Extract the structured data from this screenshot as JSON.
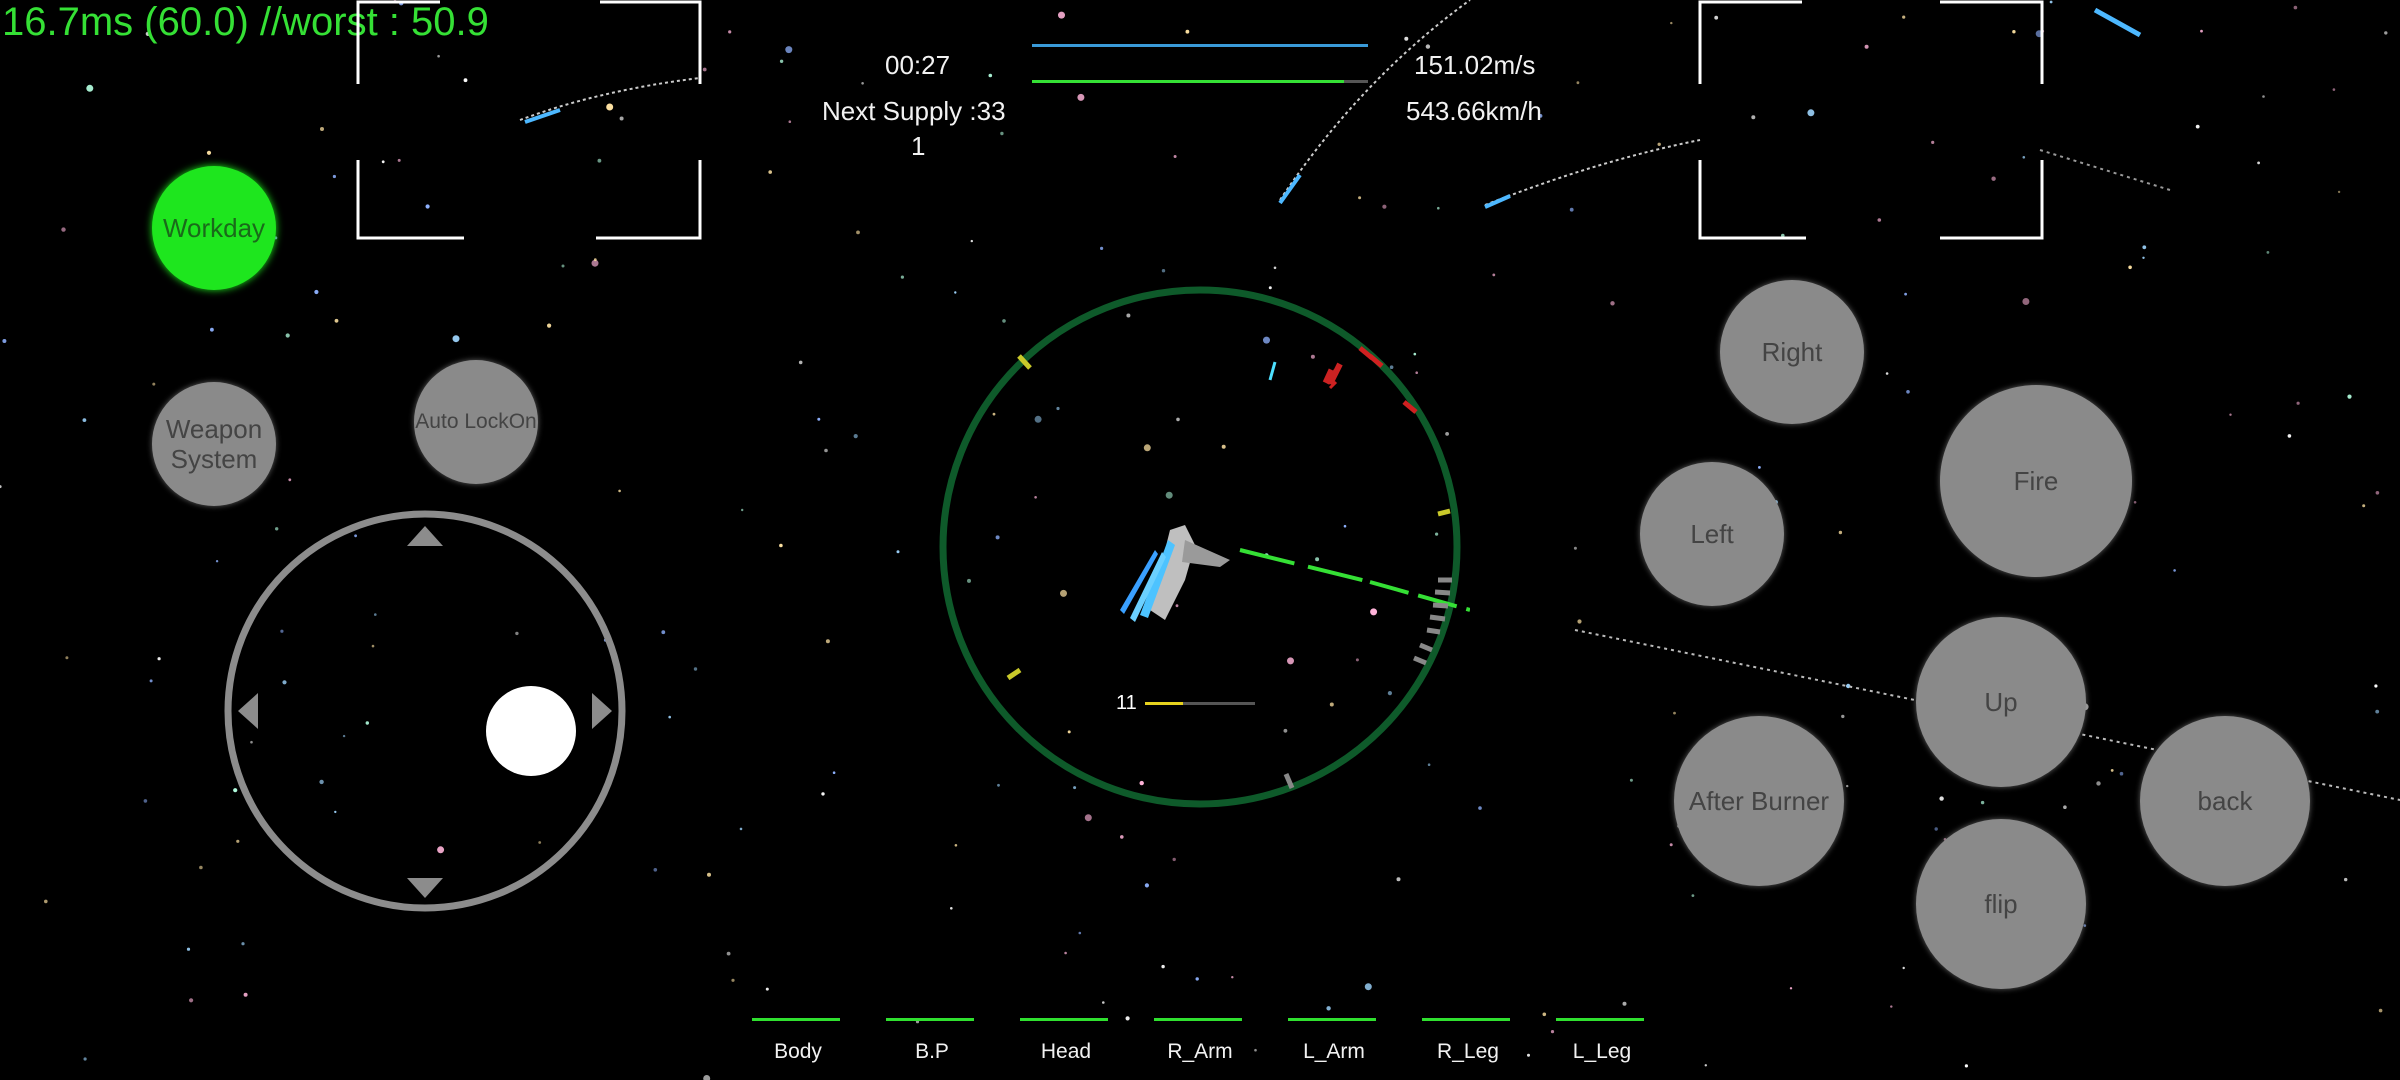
{
  "perf": {
    "text": "16.7ms (60.0) //worst : 50.9"
  },
  "hud": {
    "timer": "00:27",
    "next_supply": "Next Supply :33",
    "supply_count": "1",
    "speed_ms": "151.02m/s",
    "speed_kmh": "543.66km/h",
    "ammo_count": "11"
  },
  "buttons": {
    "workday": "Workday",
    "weapon_system": "Weapon System",
    "auto_lockon": "Auto LockOn",
    "right": "Right",
    "left": "Left",
    "fire": "Fire",
    "up": "Up",
    "after_burner": "After Burner",
    "back": "back",
    "flip": "flip"
  },
  "parts": [
    "Body",
    "B.P",
    "Head",
    "R_Arm",
    "L_Arm",
    "R_Leg",
    "L_Leg"
  ],
  "colors": {
    "perf": "#35e035",
    "workday": "#1ee61e",
    "button_gray": "#8a8a8a",
    "radar_ring": "#0e5a2a",
    "health_bar": "#2fe02f",
    "lock_line": "#35e035"
  },
  "icons": [
    "joystick-up-arrow-icon",
    "joystick-down-arrow-icon",
    "joystick-left-arrow-icon",
    "joystick-right-arrow-icon",
    "mech-ship-icon"
  ]
}
